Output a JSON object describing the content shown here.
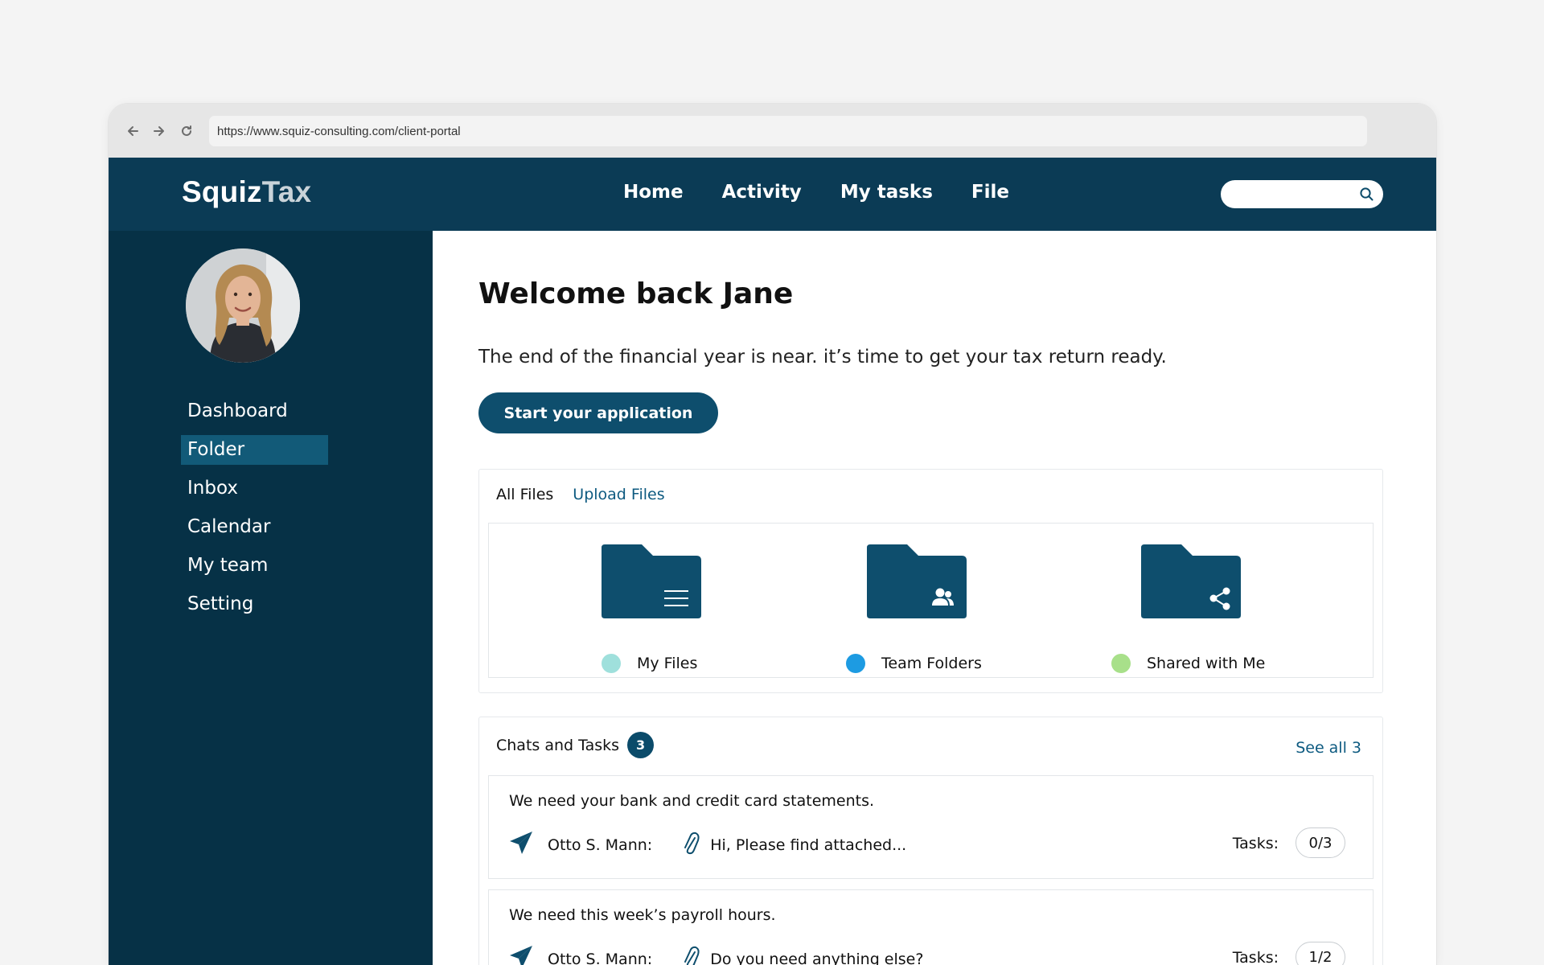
{
  "browser": {
    "url": "https://www.squiz-consulting.com/client-portal"
  },
  "brand": {
    "logo_primary": "Squiz",
    "logo_secondary": "Tax"
  },
  "topnav": {
    "items": [
      "Home",
      "Activity",
      "My tasks",
      "File"
    ],
    "search_placeholder": ""
  },
  "sidebar": {
    "items": [
      {
        "label": "Dashboard",
        "active": false
      },
      {
        "label": "Folder",
        "active": true
      },
      {
        "label": "Inbox",
        "active": false
      },
      {
        "label": "Calendar",
        "active": false
      },
      {
        "label": "My team",
        "active": false
      },
      {
        "label": "Setting",
        "active": false
      }
    ]
  },
  "main": {
    "welcome": "Welcome back Jane",
    "subtitle": "The end of the financial year is near. it’s time to get your tax return ready.",
    "cta_label": "Start your application"
  },
  "files": {
    "tabs": [
      {
        "label": "All Files",
        "active": true
      },
      {
        "label": "Upload Files",
        "active": false
      }
    ],
    "folders": [
      {
        "label": "My Files",
        "icon": "folder-lines-icon",
        "dot_color": "#9fe0dc"
      },
      {
        "label": "Team Folders",
        "icon": "folder-team-icon",
        "dot_color": "#1d9be2"
      },
      {
        "label": "Shared with Me",
        "icon": "folder-share-icon",
        "dot_color": "#a8e08a"
      }
    ]
  },
  "chats": {
    "title": "Chats and Tasks",
    "count": "3",
    "see_all": "See all 3",
    "items": [
      {
        "message": "We need your bank and credit card statements.",
        "sender": "Otto S. Mann:",
        "preview": "Hi, Please find attached...",
        "tasks_label": "Tasks:",
        "tasks": "0/3"
      },
      {
        "message": "We need this week’s payroll hours.",
        "sender": "Otto S. Mann:",
        "preview": "Do you need anything else?",
        "tasks_label": "Tasks:",
        "tasks": "1/2"
      }
    ]
  },
  "colors": {
    "topnav_bg": "#0b3b55",
    "sidebar_bg": "#063146",
    "accent": "#0e4e6d",
    "link": "#0d5a80"
  }
}
